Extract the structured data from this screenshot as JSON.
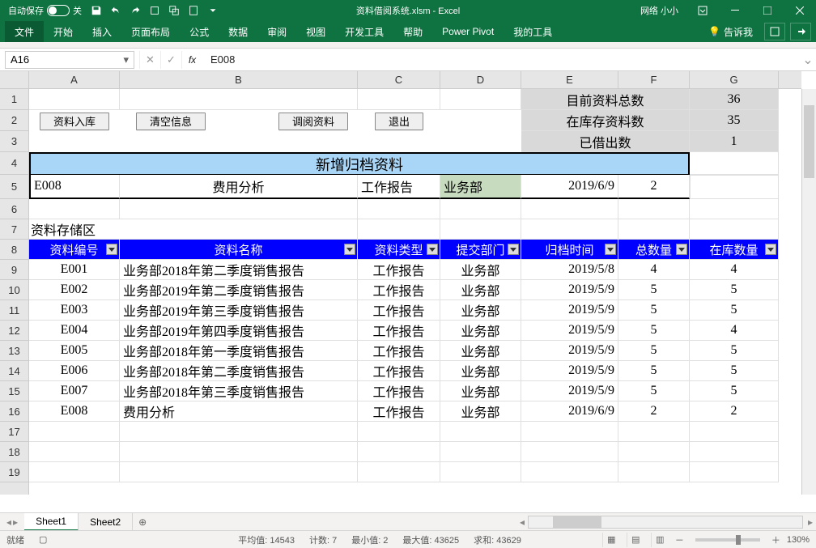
{
  "titlebar": {
    "autosave_label": "自动保存",
    "autosave_state_off": "关",
    "filename": "资料借阅系统.xlsm - Excel",
    "username": "网络 小小"
  },
  "ribbon": {
    "file": "文件",
    "tabs": [
      "开始",
      "插入",
      "页面布局",
      "公式",
      "数据",
      "审阅",
      "视图",
      "开发工具",
      "帮助",
      "Power Pivot",
      "我的工具"
    ],
    "tell_me": "告诉我"
  },
  "formula_bar": {
    "name_box": "A16",
    "value": "E008"
  },
  "columns": [
    "A",
    "B",
    "C",
    "D",
    "E",
    "F",
    "G"
  ],
  "row_count": 19,
  "summary": {
    "total_label": "目前资料总数",
    "total_value": "36",
    "instock_label": "在库存资料数",
    "instock_value": "35",
    "lent_label": "已借出数",
    "lent_value": "1"
  },
  "buttons": {
    "in": "资料入库",
    "clear": "清空信息",
    "lend": "调阅资料",
    "exit": "退出"
  },
  "archive": {
    "title": "新增归档资料",
    "row": {
      "id": "E008",
      "name": "费用分析",
      "type": "工作报告",
      "dept": "业务部",
      "date": "2019/6/9",
      "qty": "2"
    }
  },
  "storage_label": "资料存储区",
  "table": {
    "headers": [
      "资料编号",
      "资料名称",
      "资料类型",
      "提交部门",
      "归档时间",
      "总数量",
      "在库数量"
    ],
    "rows": [
      {
        "id": "E001",
        "name": "业务部2018年第二季度销售报告",
        "type": "工作报告",
        "dept": "业务部",
        "date": "2019/5/8",
        "total": "4",
        "stock": "4"
      },
      {
        "id": "E002",
        "name": "业务部2019年第二季度销售报告",
        "type": "工作报告",
        "dept": "业务部",
        "date": "2019/5/9",
        "total": "5",
        "stock": "5"
      },
      {
        "id": "E003",
        "name": "业务部2019年第三季度销售报告",
        "type": "工作报告",
        "dept": "业务部",
        "date": "2019/5/9",
        "total": "5",
        "stock": "5"
      },
      {
        "id": "E004",
        "name": "业务部2019年第四季度销售报告",
        "type": "工作报告",
        "dept": "业务部",
        "date": "2019/5/9",
        "total": "5",
        "stock": "4"
      },
      {
        "id": "E005",
        "name": "业务部2018年第一季度销售报告",
        "type": "工作报告",
        "dept": "业务部",
        "date": "2019/5/9",
        "total": "5",
        "stock": "5"
      },
      {
        "id": "E006",
        "name": "业务部2018年第二季度销售报告",
        "type": "工作报告",
        "dept": "业务部",
        "date": "2019/5/9",
        "total": "5",
        "stock": "5"
      },
      {
        "id": "E007",
        "name": "业务部2018年第三季度销售报告",
        "type": "工作报告",
        "dept": "业务部",
        "date": "2019/5/9",
        "total": "5",
        "stock": "5"
      },
      {
        "id": "E008",
        "name": "费用分析",
        "type": "工作报告",
        "dept": "业务部",
        "date": "2019/6/9",
        "total": "2",
        "stock": "2"
      }
    ]
  },
  "sheets": {
    "active": "Sheet1",
    "other": "Sheet2"
  },
  "status": {
    "ready": "就绪",
    "avg": "平均值: 14543",
    "count": "计数: 7",
    "min": "最小值: 2",
    "max": "最大值: 43625",
    "sum": "求和: 43629",
    "zoom": "130%"
  }
}
